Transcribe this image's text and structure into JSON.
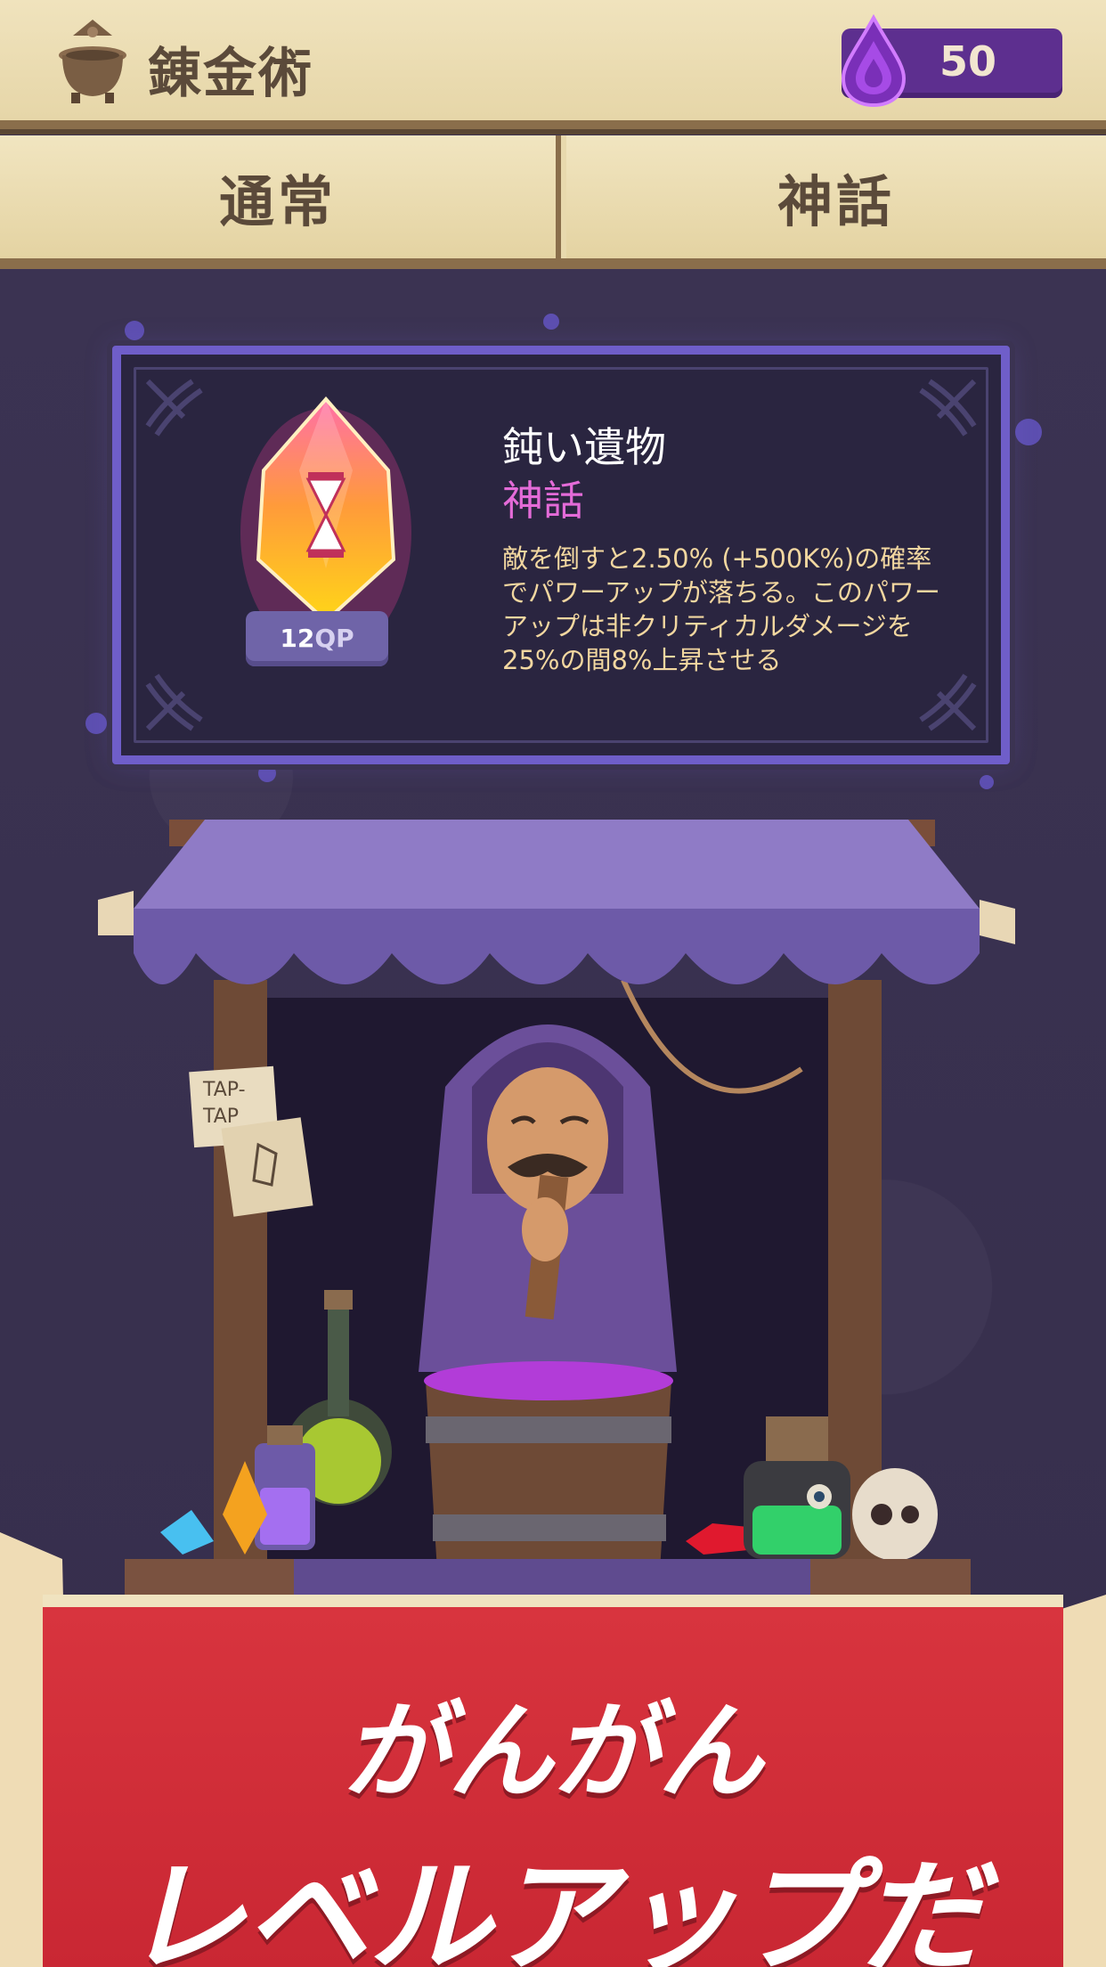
{
  "header": {
    "title": "錬金術",
    "title_icon": "cauldron-icon",
    "currency_icon": "mythic-drop-icon",
    "currency_value": "50"
  },
  "tabs": [
    {
      "label": "通常"
    },
    {
      "label": "神話"
    }
  ],
  "card": {
    "name": "鈍い遺物",
    "rarity": "神話",
    "description": "敵を倒すと2.50% (+500K%)の確率でパワーアップが落ちる。このパワーアップは非クリティカルダメージを25%の間8%上昇させる",
    "qp_value": "12",
    "qp_unit": "QP",
    "gem_icon": "hourglass-crystal-icon"
  },
  "scene": {
    "sign_text": "TAP-TAP"
  },
  "banner": {
    "line1": "がんがん",
    "line2": "レベルアップだ"
  },
  "colors": {
    "header_bg": "#efe2bb",
    "card_border": "#6f5ec9",
    "rarity_mythic": "#e46bd8",
    "banner_red": "#d12f3a",
    "currency_bg": "#5d2f8f"
  }
}
